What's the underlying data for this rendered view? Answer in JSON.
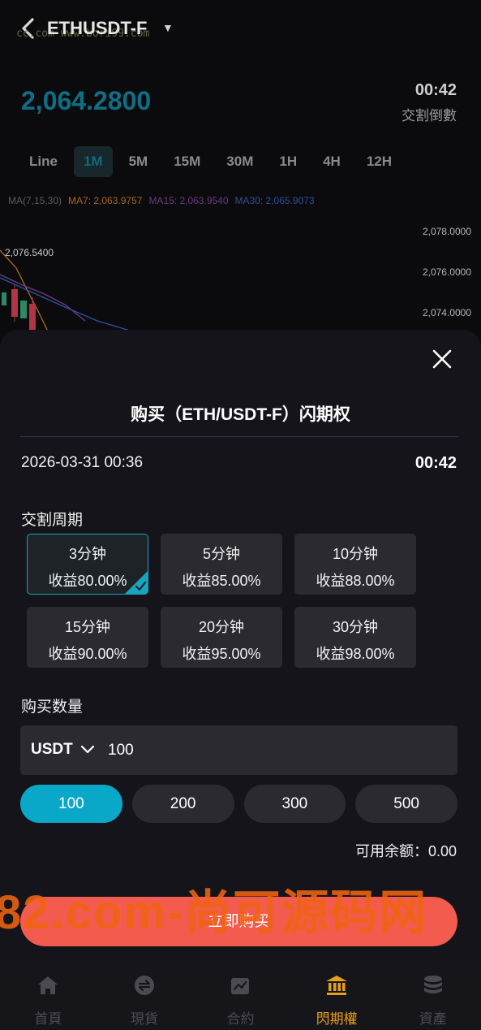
{
  "header": {
    "symbol": "ETHUSDT-F",
    "caret": "▼",
    "watermark_url": "cc.com  www.bori99.com"
  },
  "ticker": {
    "price": "2,064.2800",
    "countdown": "00:42",
    "countdown_label": "交割倒數"
  },
  "intervals": [
    "Line",
    "1M",
    "5M",
    "15M",
    "30M",
    "1H",
    "4H",
    "12H"
  ],
  "active_interval": "1M",
  "ma": {
    "ma_all": "MA(7,15,30)",
    "ma7": "MA7: 2,063.9757",
    "ma15": "MA15: 2,063.9540",
    "ma30": "MA30: 2,065.9073"
  },
  "chart_axis": {
    "labels": [
      "2,078.0000",
      "2,076.0000",
      "2,074.0000"
    ],
    "high_label": "2,076.5400"
  },
  "colors": {
    "accent": "#0aa8c8",
    "buy": "#f35b4e",
    "nav_active": "#e6a018",
    "ma7": "#c07a2a",
    "ma15": "#7a3f8f",
    "ma30": "#2b5aa8"
  },
  "modal": {
    "title": "购买（ETH/USDT-F）闪期权",
    "date": "2026-03-31 00:36",
    "timer": "00:42",
    "period_label": "交割周期",
    "periods": [
      {
        "label": "3分钟",
        "return": "收益80.00%"
      },
      {
        "label": "5分钟",
        "return": "收益85.00%"
      },
      {
        "label": "10分钟",
        "return": "收益88.00%"
      },
      {
        "label": "15分钟",
        "return": "收益90.00%"
      },
      {
        "label": "20分钟",
        "return": "收益95.00%"
      },
      {
        "label": "30分钟",
        "return": "收益98.00%"
      }
    ],
    "quantity_label": "购买数量",
    "currency": "USDT",
    "amount": "100",
    "quick_amounts": [
      "100",
      "200",
      "300",
      "500"
    ],
    "balance": "可用余额：0.00",
    "buy_label": "立即购买",
    "watermark": "82.com-尚可源码网"
  },
  "nav": [
    {
      "label": "首頁",
      "icon": "home-icon"
    },
    {
      "label": "現貨",
      "icon": "exchange-icon"
    },
    {
      "label": "合約",
      "icon": "contract-icon"
    },
    {
      "label": "閃期權",
      "icon": "bank-icon"
    },
    {
      "label": "資產",
      "icon": "coins-icon"
    }
  ]
}
